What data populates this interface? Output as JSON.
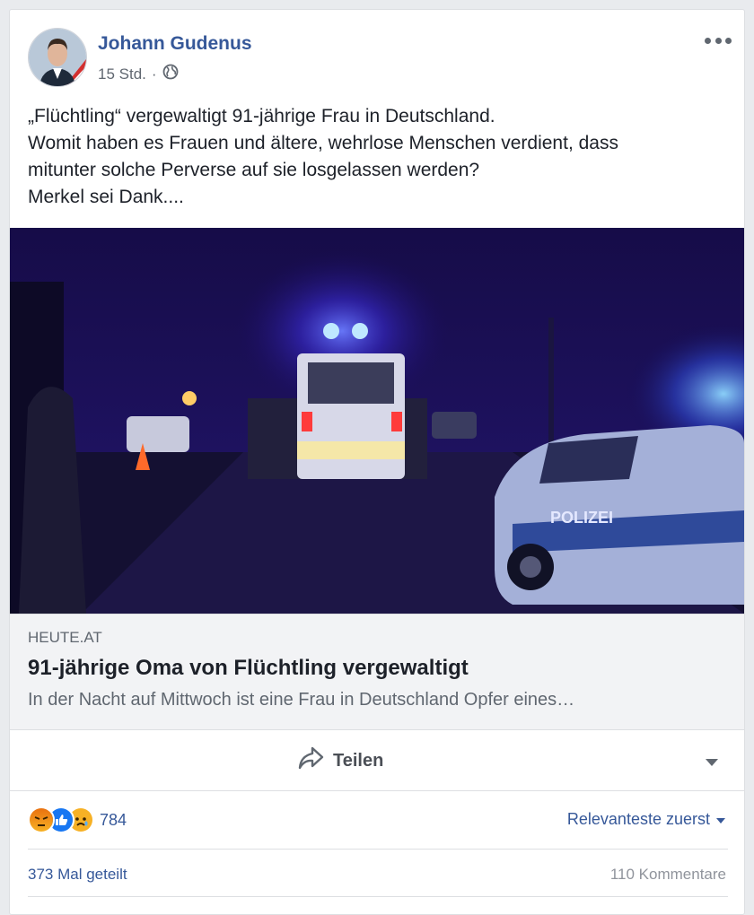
{
  "post": {
    "author": "Johann Gudenus",
    "time": "15 Std.",
    "separator": "·",
    "privacy_icon": "globe-icon",
    "more_icon": "more-options-icon",
    "text_lines": [
      "„Flüchtling“ vergewaltigt 91-jährige Frau in Deutschland.",
      "Womit haben es Frauen und ältere, wehrlose Menschen verdient, dass",
      "mitunter solche Perverse auf sie losgelassen werden?",
      "Merkel sei Dank...."
    ]
  },
  "link": {
    "image_text": "POLIZEI",
    "domain": "HEUTE.AT",
    "headline": "91-jährige Oma von Flüchtling vergewaltigt",
    "description": "In der Nacht auf Mittwoch ist eine Frau in Deutschland Opfer eines…"
  },
  "actions": {
    "share_label": "Teilen",
    "share_icon": "share-arrow-icon",
    "dropdown_icon": "caret-down-icon"
  },
  "stats": {
    "reaction_icons": [
      "angry-reaction-icon",
      "like-reaction-icon",
      "sad-reaction-icon"
    ],
    "reaction_count": "784",
    "sort_label": "Relevanteste zuerst",
    "shares": "373 Mal geteilt",
    "comments": "110 Kommentare"
  },
  "colors": {
    "link_blue": "#365899",
    "like_blue": "#1877f2",
    "reaction_yellow": "#f7b125",
    "angry_red": "#e9710f"
  }
}
